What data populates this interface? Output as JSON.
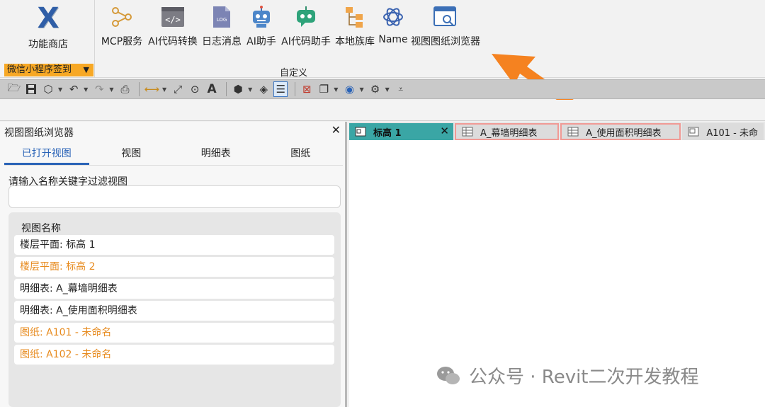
{
  "ribbon": {
    "store_label": "功能商店",
    "mini_program_label": "微信小程序签到",
    "group_label": "自定义",
    "tools": [
      {
        "label": "MCP服务",
        "icon": "mcp-nodes-icon"
      },
      {
        "label": "AI代码转换",
        "icon": "code-window-icon"
      },
      {
        "label": "日志消息",
        "icon": "log-file-icon"
      },
      {
        "label": "AI助手",
        "icon": "robot-icon"
      },
      {
        "label": "AI代码助手",
        "icon": "robot-chat-icon"
      },
      {
        "label": "本地族库",
        "icon": "tree-folders-icon"
      },
      {
        "label": "Name",
        "icon": "openai-knot-icon"
      },
      {
        "label": "视图图纸浏览器",
        "icon": "window-search-icon"
      }
    ]
  },
  "browser": {
    "title": "视图图纸浏览器",
    "tabs": [
      "已打开视图",
      "视图",
      "明细表",
      "图纸"
    ],
    "filter_label": "请输入名称关键字过滤视图",
    "filter_value": "",
    "list_header": "视图名称",
    "rows": [
      {
        "text": "楼层平面: 标高 1",
        "status": "normal"
      },
      {
        "text": "楼层平面: 标高 2",
        "status": "highlight"
      },
      {
        "text": "明细表: A_幕墙明细表",
        "status": "normal"
      },
      {
        "text": "明细表: A_使用面积明细表",
        "status": "normal"
      },
      {
        "text": "图纸: A101 - 未命名",
        "status": "highlight"
      },
      {
        "text": "图纸: A102 - 未命名",
        "status": "highlight"
      }
    ]
  },
  "doc_tabs": [
    {
      "label": "标高 1",
      "state": "active"
    },
    {
      "label": "A_幕墙明细表",
      "state": "outlined"
    },
    {
      "label": "A_使用面积明细表",
      "state": "outlined"
    },
    {
      "label": "A101 - 未命",
      "state": "normal"
    }
  ],
  "watermark": "公众号 · Revit二次开发教程",
  "colors": {
    "accent": "#2a63b7",
    "highlight_text": "#e78a1d",
    "active_tab": "#3aa6a5",
    "arrow": "#f58220"
  }
}
